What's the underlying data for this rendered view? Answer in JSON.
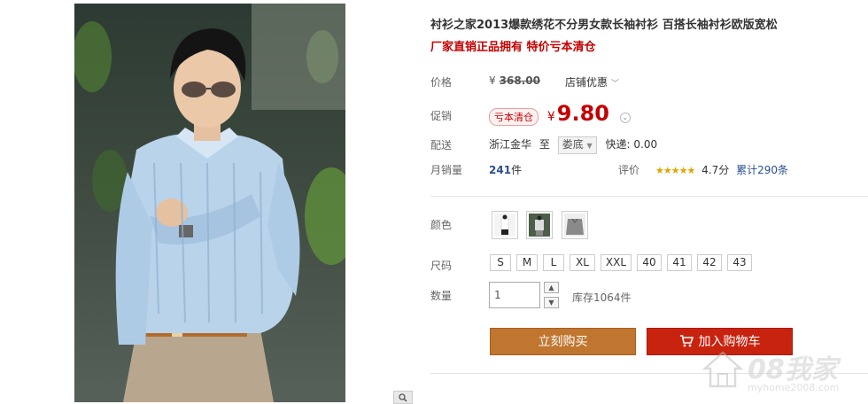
{
  "product": {
    "title": "衬衫之家2013爆款绣花不分男女款长袖衬衫 百搭长袖衬衫欧版宽松",
    "subtitle": "厂家直销正品拥有 特价亏本清仓"
  },
  "price": {
    "label": "价格",
    "currency": "¥",
    "original": "368.00",
    "store_discount": "店铺优惠"
  },
  "promo": {
    "label": "促销",
    "tag": "亏本清仓",
    "currency": "¥",
    "price": "9.80"
  },
  "shipping": {
    "label": "配送",
    "from": "浙江金华",
    "to_word": "至",
    "destination": "娄底",
    "fee_text": "快递: 0.00"
  },
  "sales": {
    "label": "月销量",
    "count": "241",
    "unit": "件",
    "rating_label": "评价",
    "stars": "★★★★★",
    "score": "4.7分",
    "reviews": "累计290条"
  },
  "color": {
    "label": "颜色"
  },
  "size": {
    "label": "尺码",
    "options": [
      "S",
      "M",
      "L",
      "XL",
      "XXL",
      "40",
      "41",
      "42",
      "43"
    ]
  },
  "quantity": {
    "label": "数量",
    "value": "1",
    "up": "▲",
    "down": "▼",
    "stock": "库存1064件"
  },
  "actions": {
    "buy_now": "立刻购买",
    "add_to_cart": "加入购物车"
  },
  "watermark": {
    "brand": "08我家",
    "url": "myhome2008.com"
  },
  "colors": {
    "accent_red": "#c40000",
    "buy_button": "#c0762f",
    "cart_button": "#c8230f"
  }
}
